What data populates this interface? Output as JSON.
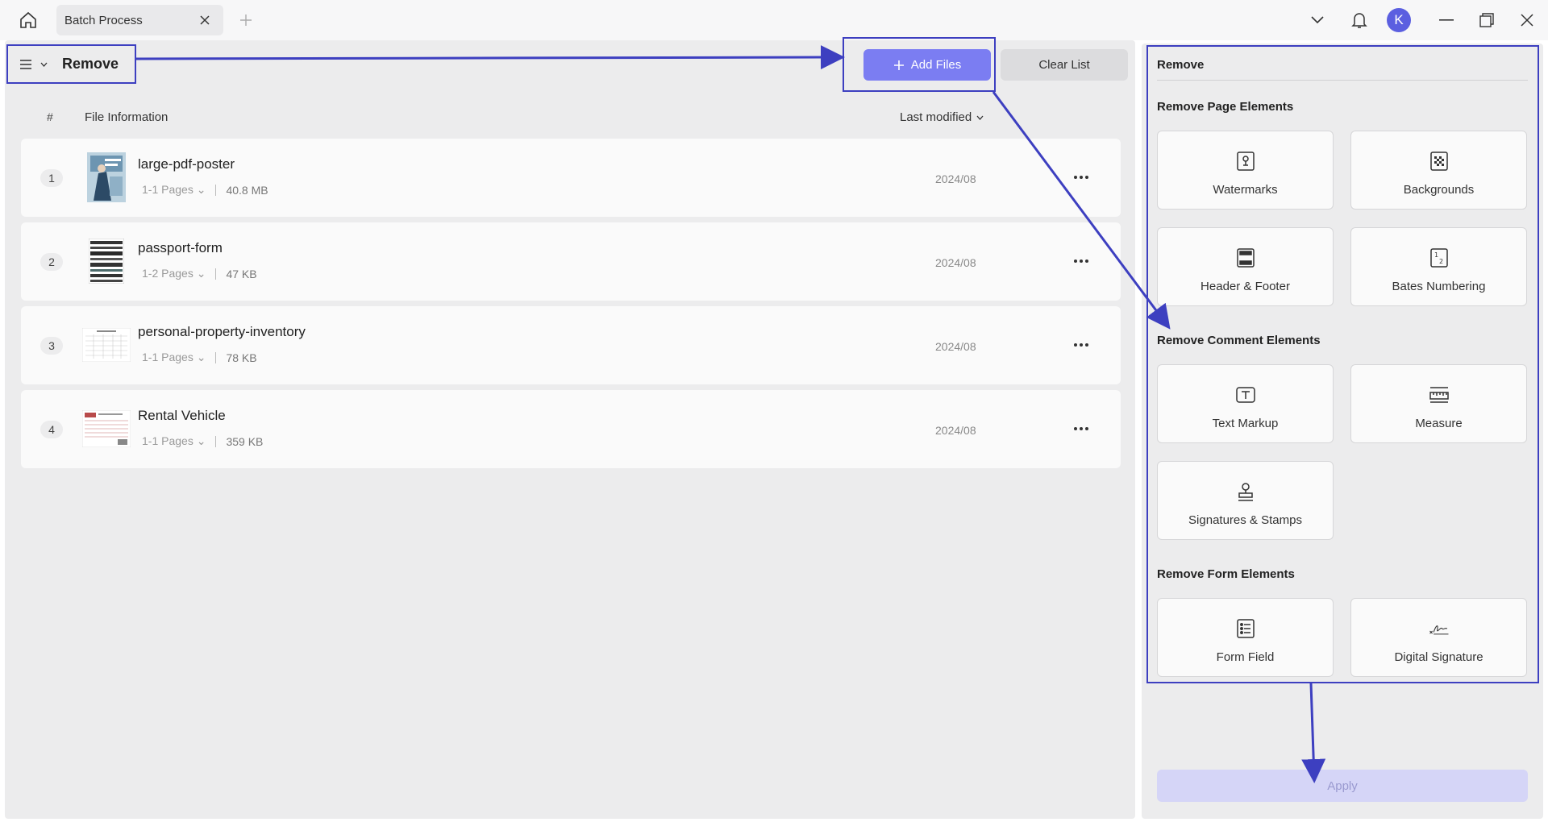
{
  "tab": {
    "title": "Batch Process"
  },
  "user": {
    "initial": "K"
  },
  "toolbar": {
    "menu_title": "Remove",
    "add_files_label": "Add Files",
    "clear_list_label": "Clear List"
  },
  "list_header": {
    "number": "#",
    "file_info": "File Information",
    "sort_label": "Last modified"
  },
  "files": [
    {
      "num": "1",
      "name": "large-pdf-poster",
      "pages": "1-1 Pages",
      "size": "40.8 MB",
      "date": "2024/08"
    },
    {
      "num": "2",
      "name": "passport-form",
      "pages": "1-2 Pages",
      "size": "47 KB",
      "date": "2024/08"
    },
    {
      "num": "3",
      "name": "personal-property-inventory",
      "pages": "1-1 Pages",
      "size": "78 KB",
      "date": "2024/08"
    },
    {
      "num": "4",
      "name": "Rental Vehicle",
      "pages": "1-1 Pages",
      "size": "359 KB",
      "date": "2024/08"
    }
  ],
  "panel": {
    "title": "Remove",
    "sections": {
      "page": "Remove Page Elements",
      "comment": "Remove Comment Elements",
      "form": "Remove Form Elements"
    },
    "tiles": {
      "watermarks": "Watermarks",
      "backgrounds": "Backgrounds",
      "header_footer": "Header & Footer",
      "bates": "Bates Numbering",
      "text_markup": "Text Markup",
      "measure": "Measure",
      "signatures": "Signatures & Stamps",
      "form_field": "Form Field",
      "digital_signature": "Digital Signature"
    },
    "apply_label": "Apply"
  },
  "colors": {
    "accent": "#7b7df2",
    "annotation": "#3d3fc0",
    "apply_disabled": "#d5d5f7"
  }
}
